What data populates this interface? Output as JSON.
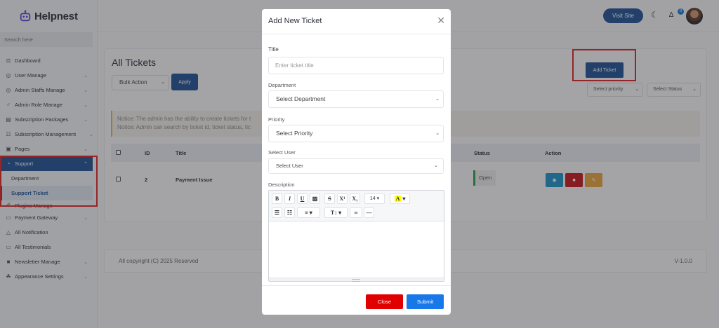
{
  "brand": {
    "name": "Helpnest",
    "logo_icon": "robot-icon"
  },
  "sidebar": {
    "search_placeholder": "Search here",
    "items": [
      {
        "label": "Dashboard",
        "icon": "dashboard-icon",
        "has_children": false
      },
      {
        "label": "User Manage",
        "icon": "user-icon",
        "has_children": true
      },
      {
        "label": "Admin Staffs Manage",
        "icon": "staff-icon",
        "has_children": true
      },
      {
        "label": "Admin Role Manage",
        "icon": "role-icon",
        "has_children": true
      },
      {
        "label": "Subscription Packages",
        "icon": "package-icon",
        "has_children": true
      },
      {
        "label": "Subscription Management",
        "icon": "subscription-icon",
        "has_children": true
      },
      {
        "label": "Pages",
        "icon": "pages-icon",
        "has_children": true
      },
      {
        "label": "Support",
        "icon": "support-icon",
        "has_children": true,
        "active": true
      },
      {
        "label": "Plugins Manage",
        "icon": "plugin-icon",
        "has_children": true
      },
      {
        "label": "Payment Gateway",
        "icon": "payment-icon",
        "has_children": true
      },
      {
        "label": "All Notification",
        "icon": "bell-icon",
        "has_children": false
      },
      {
        "label": "All Testimonials",
        "icon": "testimonial-icon",
        "has_children": false
      },
      {
        "label": "Newsletter Manage",
        "icon": "newsletter-icon",
        "has_children": true
      },
      {
        "label": "Appearance Settings",
        "icon": "appearance-icon",
        "has_children": true
      }
    ],
    "support_children": [
      {
        "label": "Department"
      },
      {
        "label": "Support Ticket",
        "current": true
      }
    ]
  },
  "topbar": {
    "visit_site": "Visit Site",
    "notification_count": "0"
  },
  "main": {
    "title": "All Tickets",
    "bulk_action": "Bulk Action",
    "apply": "Apply",
    "add_ticket": "Add Ticket",
    "priority_filter": "Select priority",
    "status_filter": "Select Status",
    "notice_lines": [
      "Notice: The admin has the ability to create tickets for t",
      "Notice: Admin can search by ticket id, ticket status, tic"
    ],
    "table": {
      "headers": [
        "ID",
        "Title",
        "Status",
        "Action"
      ],
      "rows": [
        {
          "id": "2",
          "title": "Payment Issue",
          "status": "Open"
        }
      ]
    }
  },
  "footer": {
    "copyright": "All copyright (C) 2025 Reserved",
    "version": "V-1.0.0"
  },
  "modal": {
    "title": "Add New Ticket",
    "title_label": "Title",
    "title_placeholder": "Enter ticket title",
    "department_label": "Department",
    "department_value": "Select Department",
    "priority_label": "Priority",
    "priority_value": "Select Priority",
    "user_label": "Select User",
    "user_value": "Select User",
    "description_label": "Description",
    "font_size": "14",
    "close_label": "Close",
    "submit_label": "Submit"
  },
  "colors": {
    "primary": "#1e5192",
    "danger": "#e10000",
    "submit": "#1878e8",
    "highlight": "#e02424",
    "status_open": "#2e9e47"
  }
}
